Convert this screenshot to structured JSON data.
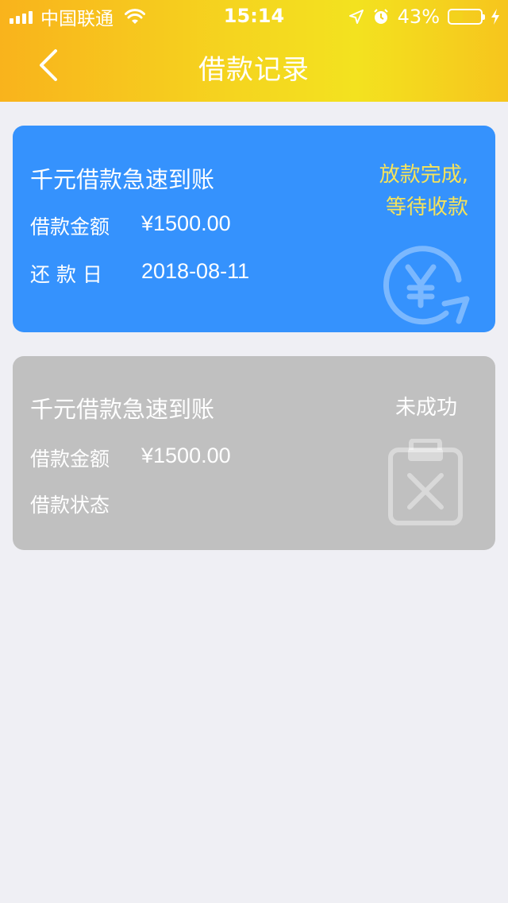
{
  "status_bar": {
    "carrier": "中国联通",
    "time": "15:14",
    "battery": "43%",
    "battery_level": 0.43
  },
  "nav": {
    "title": "借款记录"
  },
  "records": [
    {
      "title": "千元借款急速到账",
      "amount_label": "借款金额",
      "amount": "¥1500.00",
      "date_label": "还 款 日",
      "date": "2018-08-11",
      "status_line1": "放款完成,",
      "status_line2": "等待收款",
      "status_color": "#f6e35a",
      "background": "#3592fd",
      "icon": "yen-refresh-icon"
    },
    {
      "title": "千元借款急速到账",
      "amount_label": "借款金额",
      "amount": "¥1500.00",
      "status_label": "借款状态",
      "status": "未成功",
      "background": "#c0c0c0",
      "icon": "clipboard-failed-icon"
    }
  ],
  "colors": {
    "header_gradient_start": "#f9b31c",
    "header_gradient_end": "#f3e21f",
    "page_background": "#efeff4"
  }
}
